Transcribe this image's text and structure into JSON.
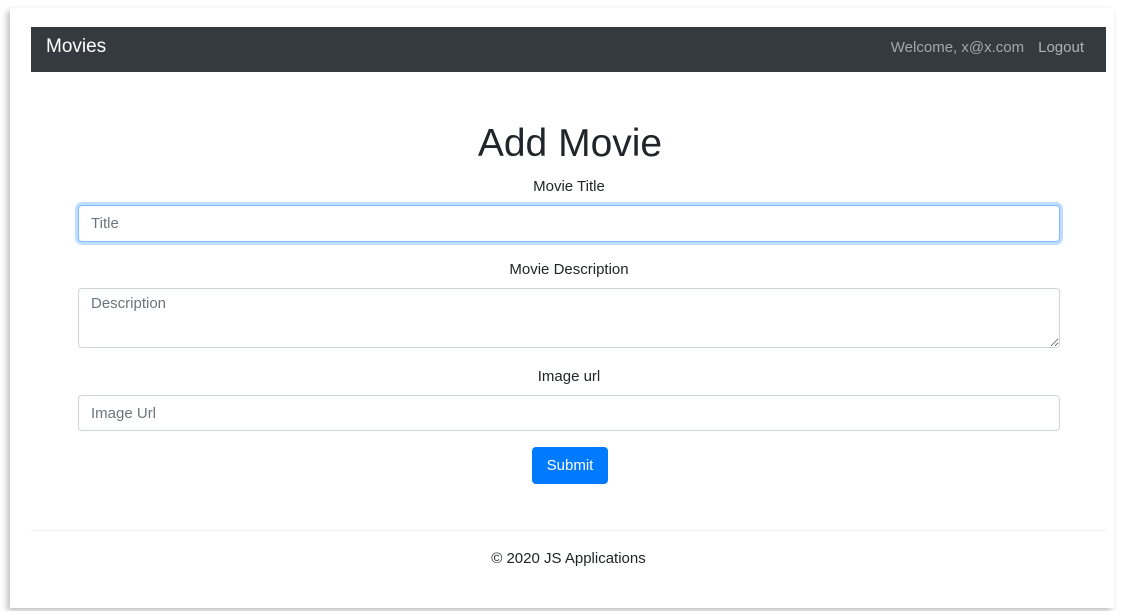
{
  "navbar": {
    "brand": "Movies",
    "welcome": "Welcome, x@x.com",
    "logout": "Logout",
    "bg_color": "#343a40"
  },
  "form": {
    "heading": "Add Movie",
    "title_label": "Movie Title",
    "title_placeholder": "Title",
    "title_value": "",
    "description_label": "Movie Description",
    "description_placeholder": "Description",
    "description_value": "",
    "image_label": "Image url",
    "image_placeholder": "Image Url",
    "image_value": "",
    "submit_label": "Submit",
    "submit_color": "#007bff"
  },
  "footer": {
    "text": "© 2020 JS Applications"
  }
}
